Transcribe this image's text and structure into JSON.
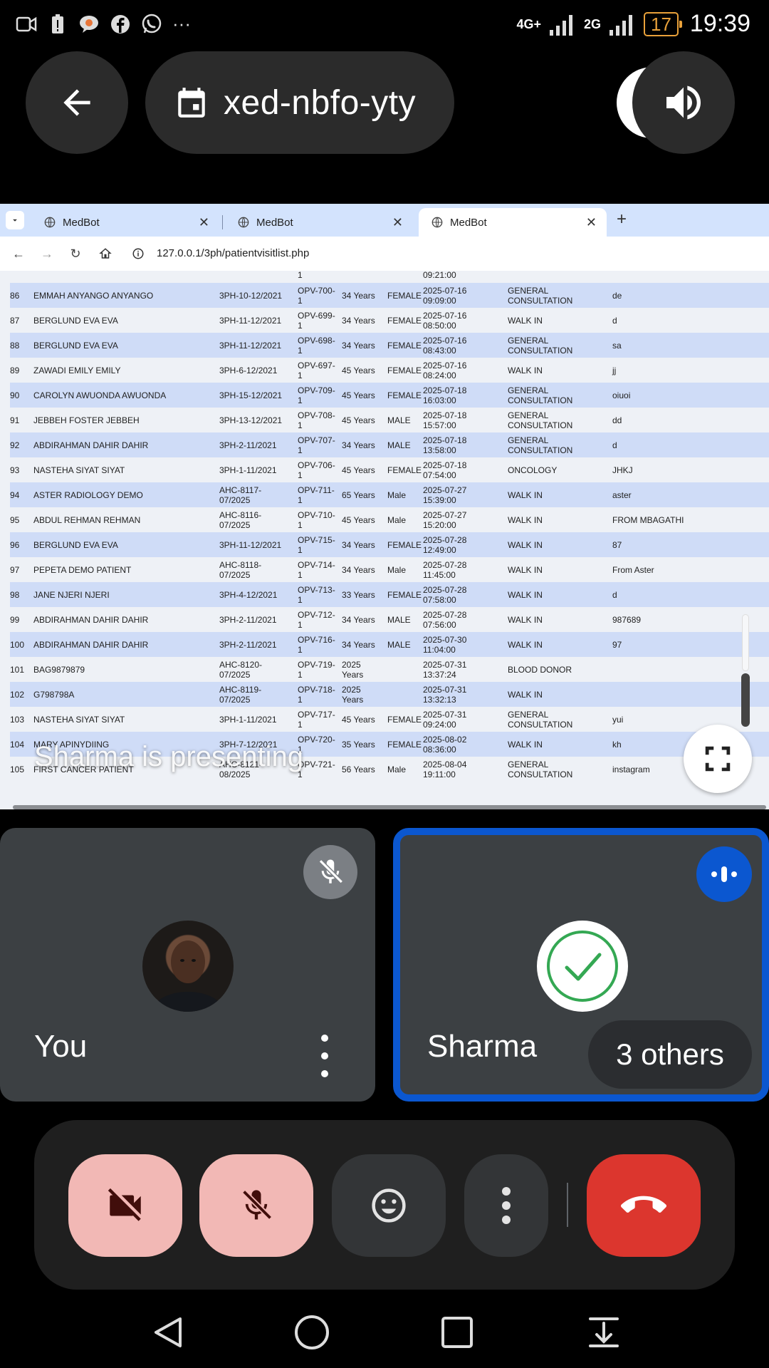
{
  "status_bar": {
    "time": "19:39",
    "battery": "17",
    "network_4g": "4G+",
    "network_2g": "2G",
    "overflow": "···"
  },
  "meet": {
    "meeting_code": "xed-nbfo-yty",
    "presenting_text": "Sharma is presenting"
  },
  "browser": {
    "tabs": [
      {
        "label": "MedBot",
        "active": false
      },
      {
        "label": "MedBot",
        "active": false
      },
      {
        "label": "MedBot",
        "active": true
      }
    ],
    "url": "127.0.0.1/3ph/patientvisitlist.php"
  },
  "table": {
    "partial_top_row": {
      "c3": "1",
      "c6": "09:21:00"
    },
    "rows": [
      {
        "no": "86",
        "name": "EMMAH ANYANGO ANYANGO",
        "reg": "3PH-10-12/2021",
        "opv": [
          "OPV-700-",
          "1"
        ],
        "age": "34 Years",
        "sex": "FEMALE",
        "date": [
          "2025-07-16",
          "09:09:00"
        ],
        "dept": [
          "GENERAL",
          "CONSULTATION"
        ],
        "notes": "de"
      },
      {
        "no": "87",
        "name": "BERGLUND EVA EVA",
        "reg": "3PH-11-12/2021",
        "opv": [
          "OPV-699-",
          "1"
        ],
        "age": "34 Years",
        "sex": "FEMALE",
        "date": [
          "2025-07-16",
          "08:50:00"
        ],
        "dept": [
          "WALK IN"
        ],
        "notes": "d"
      },
      {
        "no": "88",
        "name": "BERGLUND EVA EVA",
        "reg": "3PH-11-12/2021",
        "opv": [
          "OPV-698-",
          "1"
        ],
        "age": "34 Years",
        "sex": "FEMALE",
        "date": [
          "2025-07-16",
          "08:43:00"
        ],
        "dept": [
          "GENERAL",
          "CONSULTATION"
        ],
        "notes": "sa"
      },
      {
        "no": "89",
        "name": "ZAWADI EMILY EMILY",
        "reg": "3PH-6-12/2021",
        "opv": [
          "OPV-697-",
          "1"
        ],
        "age": "45 Years",
        "sex": "FEMALE",
        "date": [
          "2025-07-16",
          "08:24:00"
        ],
        "dept": [
          "WALK IN"
        ],
        "notes": "jj"
      },
      {
        "no": "90",
        "name": "CAROLYN AWUONDA AWUONDA",
        "reg": "3PH-15-12/2021",
        "opv": [
          "OPV-709-",
          "1"
        ],
        "age": "45 Years",
        "sex": "FEMALE",
        "date": [
          "2025-07-18",
          "16:03:00"
        ],
        "dept": [
          "GENERAL",
          "CONSULTATION"
        ],
        "notes": "oiuoi"
      },
      {
        "no": "91",
        "name": "JEBBEH FOSTER JEBBEH",
        "reg": "3PH-13-12/2021",
        "opv": [
          "OPV-708-",
          "1"
        ],
        "age": "45 Years",
        "sex": "MALE",
        "date": [
          "2025-07-18",
          "15:57:00"
        ],
        "dept": [
          "GENERAL",
          "CONSULTATION"
        ],
        "notes": "dd"
      },
      {
        "no": "92",
        "name": "ABDIRAHMAN DAHIR DAHIR",
        "reg": "3PH-2-11/2021",
        "opv": [
          "OPV-707-",
          "1"
        ],
        "age": "34 Years",
        "sex": "MALE",
        "date": [
          "2025-07-18",
          "13:58:00"
        ],
        "dept": [
          "GENERAL",
          "CONSULTATION"
        ],
        "notes": "d"
      },
      {
        "no": "93",
        "name": "NASTEHA SIYAT SIYAT",
        "reg": "3PH-1-11/2021",
        "opv": [
          "OPV-706-",
          "1"
        ],
        "age": "45 Years",
        "sex": "FEMALE",
        "date": [
          "2025-07-18",
          "07:54:00"
        ],
        "dept": [
          "ONCOLOGY"
        ],
        "notes": "JHKJ"
      },
      {
        "no": "94",
        "name": "ASTER RADIOLOGY DEMO",
        "reg": [
          "AHC-8117-",
          "07/2025"
        ],
        "opv": [
          "OPV-711-",
          "1"
        ],
        "age": "65 Years",
        "sex": "Male",
        "date": [
          "2025-07-27",
          "15:39:00"
        ],
        "dept": [
          "WALK IN"
        ],
        "notes": "aster"
      },
      {
        "no": "95",
        "name": "ABDUL REHMAN REHMAN",
        "reg": [
          "AHC-8116-",
          "07/2025"
        ],
        "opv": [
          "OPV-710-",
          "1"
        ],
        "age": "45 Years",
        "sex": "Male",
        "date": [
          "2025-07-27",
          "15:20:00"
        ],
        "dept": [
          "WALK IN"
        ],
        "notes": "FROM MBAGATHI"
      },
      {
        "no": "96",
        "name": "BERGLUND EVA EVA",
        "reg": "3PH-11-12/2021",
        "opv": [
          "OPV-715-",
          "1"
        ],
        "age": "34 Years",
        "sex": "FEMALE",
        "date": [
          "2025-07-28",
          "12:49:00"
        ],
        "dept": [
          "WALK IN"
        ],
        "notes": "87"
      },
      {
        "no": "97",
        "name": "PEPETA DEMO PATIENT",
        "reg": [
          "AHC-8118-",
          "07/2025"
        ],
        "opv": [
          "OPV-714-",
          "1"
        ],
        "age": "34 Years",
        "sex": "Male",
        "date": [
          "2025-07-28",
          "11:45:00"
        ],
        "dept": [
          "WALK IN"
        ],
        "notes": "From Aster"
      },
      {
        "no": "98",
        "name": "JANE NJERI NJERI",
        "reg": "3PH-4-12/2021",
        "opv": [
          "OPV-713-",
          "1"
        ],
        "age": "33 Years",
        "sex": "FEMALE",
        "date": [
          "2025-07-28",
          "07:58:00"
        ],
        "dept": [
          "WALK IN"
        ],
        "notes": "d"
      },
      {
        "no": "99",
        "name": "ABDIRAHMAN DAHIR DAHIR",
        "reg": "3PH-2-11/2021",
        "opv": [
          "OPV-712-",
          "1"
        ],
        "age": "34 Years",
        "sex": "MALE",
        "date": [
          "2025-07-28",
          "07:56:00"
        ],
        "dept": [
          "WALK IN"
        ],
        "notes": "987689"
      },
      {
        "no": "100",
        "name": "ABDIRAHMAN DAHIR DAHIR",
        "reg": "3PH-2-11/2021",
        "opv": [
          "OPV-716-",
          "1"
        ],
        "age": "34 Years",
        "sex": "MALE",
        "date": [
          "2025-07-30",
          "11:04:00"
        ],
        "dept": [
          "WALK IN"
        ],
        "notes": "97"
      },
      {
        "no": "101",
        "name": "BAG9879879",
        "reg": [
          "AHC-8120-",
          "07/2025"
        ],
        "opv": [
          "OPV-719-",
          "1"
        ],
        "age": [
          "2025",
          "Years"
        ],
        "sex": "",
        "date": [
          "2025-07-31",
          "13:37:24"
        ],
        "dept": [
          "BLOOD DONOR"
        ],
        "notes": ""
      },
      {
        "no": "102",
        "name": "G798798A",
        "reg": [
          "AHC-8119-",
          "07/2025"
        ],
        "opv": [
          "OPV-718-",
          "1"
        ],
        "age": [
          "2025",
          "Years"
        ],
        "sex": "",
        "date": [
          "2025-07-31",
          "13:32:13"
        ],
        "dept": [
          "WALK IN"
        ],
        "notes": ""
      },
      {
        "no": "103",
        "name": "NASTEHA SIYAT SIYAT",
        "reg": "3PH-1-11/2021",
        "opv": [
          "OPV-717-",
          "1"
        ],
        "age": "45 Years",
        "sex": "FEMALE",
        "date": [
          "2025-07-31",
          "09:24:00"
        ],
        "dept": [
          "GENERAL",
          "CONSULTATION"
        ],
        "notes": "yui"
      },
      {
        "no": "104",
        "name": "MARY APINYDIING",
        "reg": "3PH-7-12/2021",
        "opv": [
          "OPV-720-",
          "1"
        ],
        "age": "35 Years",
        "sex": "FEMALE",
        "date": [
          "2025-08-02",
          "08:36:00"
        ],
        "dept": [
          "WALK IN"
        ],
        "notes": "kh"
      },
      {
        "no": "105",
        "name": "FIRST CANCER PATIENT",
        "reg": [
          "AHC-8121-",
          "08/2025"
        ],
        "opv": [
          "OPV-721-",
          "1"
        ],
        "age": "56 Years",
        "sex": "Male",
        "date": [
          "2025-08-04",
          "19:11:00"
        ],
        "dept": [
          "GENERAL",
          "CONSULTATION"
        ],
        "notes": "instagram"
      }
    ]
  },
  "participants": {
    "you": {
      "name": "You"
    },
    "presenter": {
      "name": "Sharma"
    },
    "others_label": "3 others"
  },
  "colors": {
    "end_call": "#dc362e",
    "muted_control": "#f2b8b5",
    "active_speaker_border": "#0b57d0",
    "row_highlight": "#cfdcf7"
  },
  "icons": [
    "back-arrow-icon",
    "calendar-icon",
    "speaker-icon",
    "mic-off-icon",
    "camera-off-icon",
    "emoji-icon",
    "more-vert-icon",
    "end-call-icon",
    "fullscreen-icon",
    "check-icon"
  ]
}
